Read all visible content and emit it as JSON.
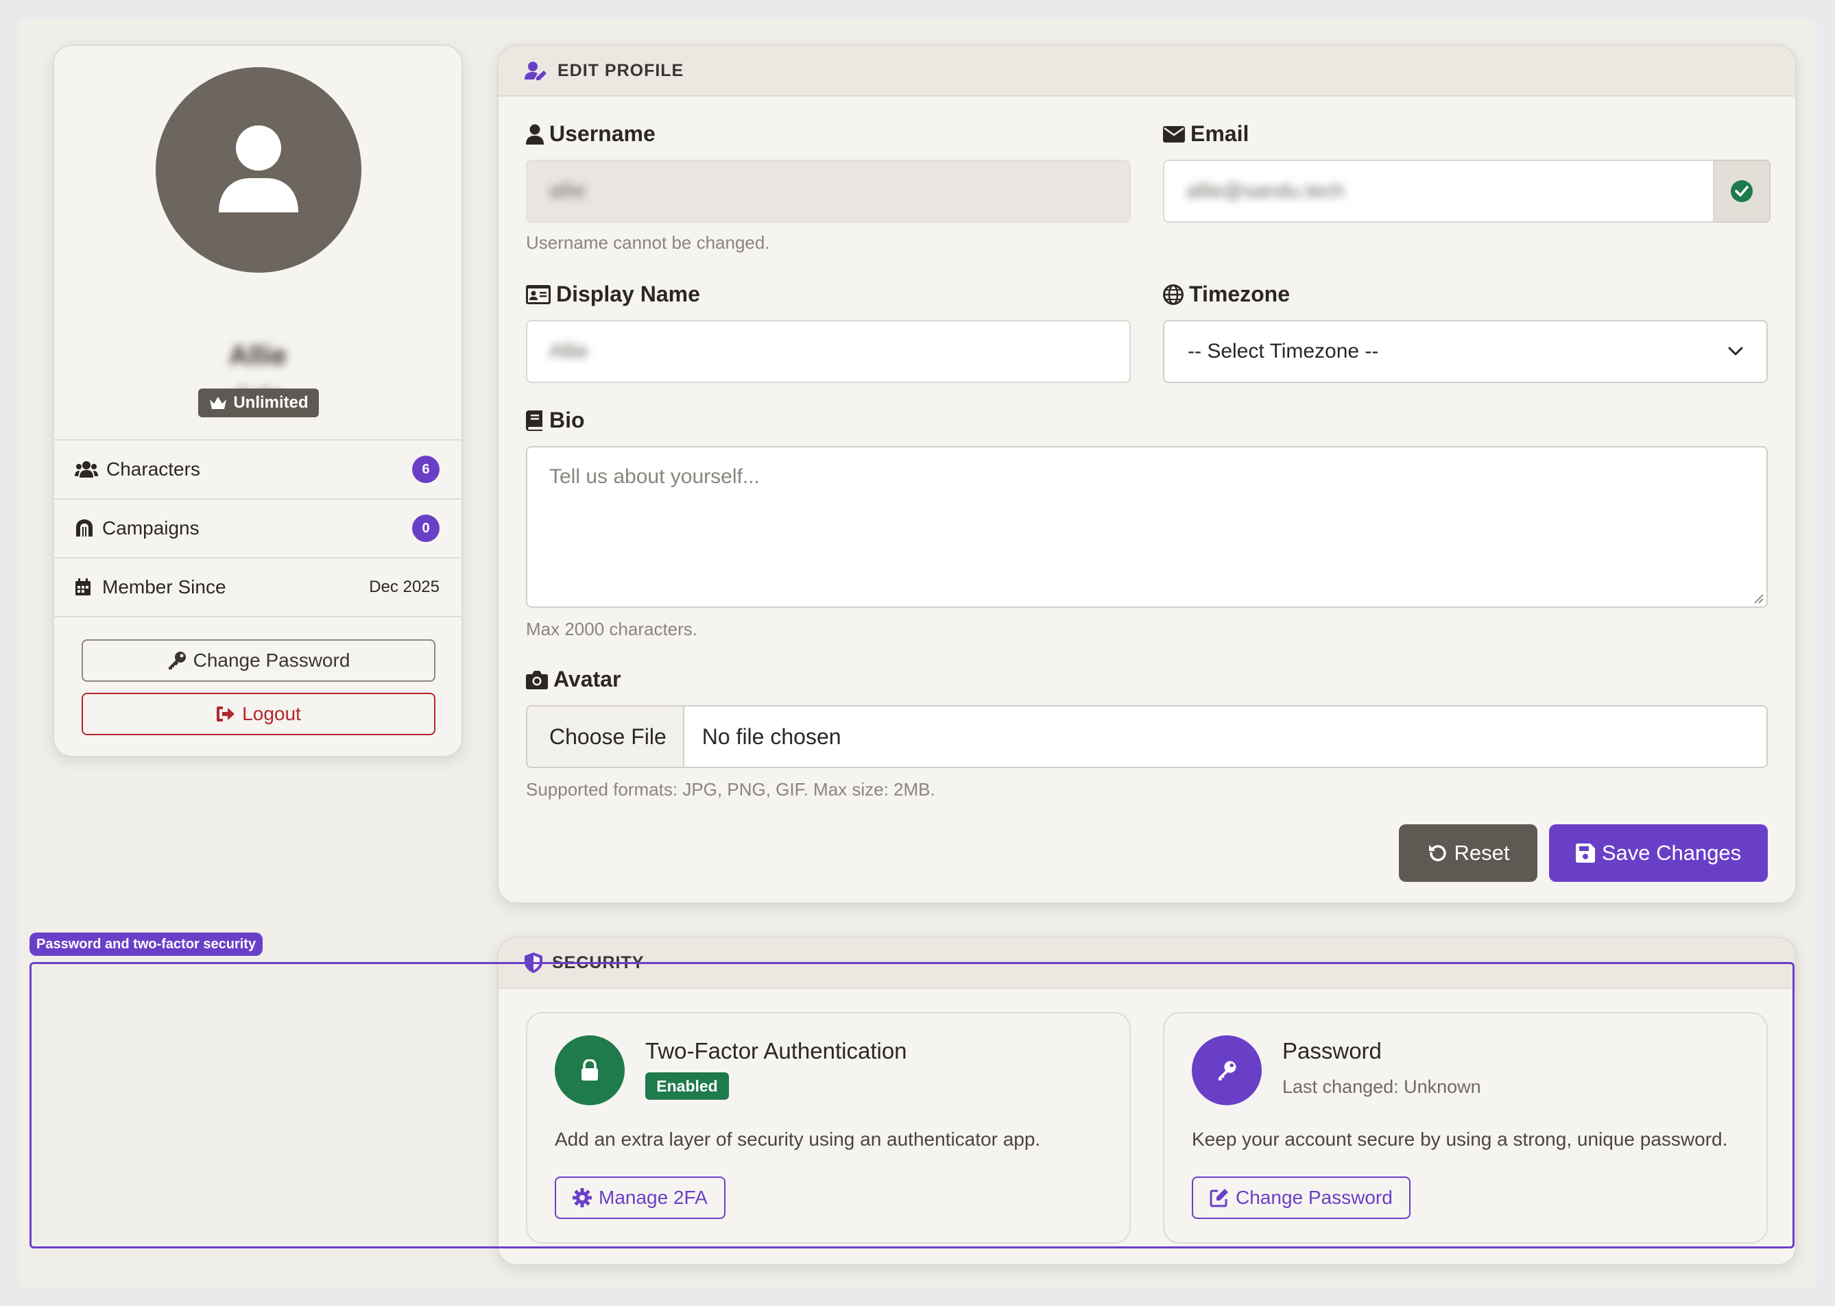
{
  "profile": {
    "display_name": "Allie",
    "handle": "@allie",
    "tier": "Unlimited",
    "stats": [
      {
        "label": "Characters",
        "value": "6"
      },
      {
        "label": "Campaigns",
        "value": "0"
      },
      {
        "label": "Member Since",
        "value": "Dec 2025"
      }
    ],
    "change_password_label": "Change Password",
    "logout_label": "Logout"
  },
  "edit_profile": {
    "header": "EDIT PROFILE",
    "username": {
      "label": "Username",
      "value": "allie",
      "help": "Username cannot be changed."
    },
    "email": {
      "label": "Email",
      "value": "allie@sandu.tech"
    },
    "display_name": {
      "label": "Display Name",
      "value": "Allie"
    },
    "timezone": {
      "label": "Timezone",
      "selected": "-- Select Timezone --"
    },
    "bio": {
      "label": "Bio",
      "placeholder": "Tell us about yourself...",
      "help": "Max 2000 characters."
    },
    "avatar": {
      "label": "Avatar",
      "button": "Choose File",
      "status": "No file chosen",
      "help": "Supported formats: JPG, PNG, GIF. Max size: 2MB."
    },
    "reset_label": "Reset",
    "save_label": "Save Changes"
  },
  "security": {
    "header": "SECURITY",
    "two_factor": {
      "title": "Two-Factor Authentication",
      "status": "Enabled",
      "description": "Add an extra layer of security using an authenticator app.",
      "button": "Manage 2FA"
    },
    "password": {
      "title": "Password",
      "subtitle": "Last changed: Unknown",
      "description": "Keep your account secure by using a strong, unique password.",
      "button": "Change Password"
    }
  },
  "highlight": {
    "label": "Password and two-factor security"
  },
  "colors": {
    "accent": "#6a3fc8",
    "danger": "#b3262e",
    "success": "#1f7a4c",
    "neutral": "#6c665e"
  },
  "icons": [
    "user-icon",
    "crown-icon",
    "users-icon",
    "dungeon-icon",
    "calendar-icon",
    "key-icon",
    "logout-icon",
    "user-edit-icon",
    "envelope-icon",
    "id-card-icon",
    "globe-icon",
    "book-icon",
    "camera-icon",
    "check-circle-icon",
    "chevron-down-icon",
    "undo-icon",
    "save-icon",
    "shield-icon",
    "lock-icon",
    "gear-icon",
    "edit-icon"
  ]
}
